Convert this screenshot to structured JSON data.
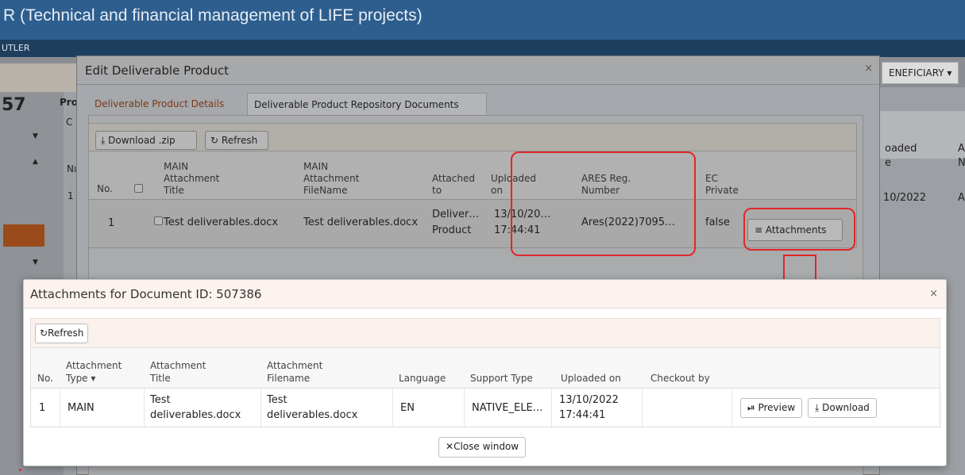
{
  "app": {
    "title": "R (Technical and financial management of LIFE projects)",
    "user": "UTLER",
    "beneficiary_label": "ENEFICIARY ▾",
    "left_number": "57",
    "proj_label": "Proj",
    "proj_c": "C",
    "bg_col_n": "Nı",
    "bg_row_one": "1",
    "right_uploaded": "oaded",
    "right_e": "e",
    "right_a": "A",
    "right_n": "N",
    "right_date": "10/2022",
    "right_a2": "A"
  },
  "edit_dialog": {
    "title": "Edit Deliverable Product",
    "close": "×",
    "tabs": [
      {
        "label": "Deliverable Product Details",
        "active": true
      },
      {
        "label": "Deliverable Product Repository Documents",
        "active": false
      }
    ],
    "toolbar": {
      "download_label": "⨯ Download .zip",
      "download_text": "Download .zip",
      "refresh_text": "Refresh"
    },
    "columns": {
      "no": "No.",
      "main_title_1": "MAIN",
      "main_title_2": "Attachment",
      "main_title_3": "Title",
      "main_file_1": "MAIN",
      "main_file_2": "Attachment",
      "main_file_3": "FileName",
      "attached_1": "Attached",
      "attached_2": "to",
      "uploaded_1": "Uploaded",
      "uploaded_2": "on",
      "ares_1": "ARES Reg.",
      "ares_2": "Number",
      "ec_1": "EC",
      "ec_2": "Private"
    },
    "rows": [
      {
        "no": "1",
        "title": "Test deliverables.docx",
        "filename": "Test deliverables.docx",
        "attached_1": "Deliver…",
        "attached_2": "Product",
        "uploaded_1": "13/10/20…",
        "uploaded_2": "17:44:41",
        "ares": "Ares(2022)7095…",
        "ec_private": "false",
        "attachments_label": "Attachments"
      }
    ]
  },
  "attachments_dialog": {
    "title": "Attachments for Document ID: 507386",
    "close": "×",
    "refresh_label": "Refresh",
    "columns": {
      "no": "No.",
      "type_1": "Attachment",
      "type_2": "Type ▾",
      "title_1": "Attachment",
      "title_2": "Title",
      "filename_1": "Attachment",
      "filename_2": "Filename",
      "language": "Language",
      "support_type": "Support Type",
      "uploaded_on": "Uploaded on",
      "checkout_by": "Checkout by"
    },
    "rows": [
      {
        "no": "1",
        "type": "MAIN",
        "title_1": "Test",
        "title_2": "deliverables.docx",
        "filename_1": "Test",
        "filename_2": "deliverables.docx",
        "language": "EN",
        "support_type": "NATIVE_ELE…",
        "uploaded_1": "13/10/2022",
        "uploaded_2": "17:44:41",
        "checkout_by": "",
        "preview_label": "Preview",
        "download_label": "Download"
      }
    ],
    "close_window_label": "Close window"
  },
  "colors": {
    "annotation_red": "#e0262a",
    "active_tab": "#7a3a17",
    "header_blue": "#2d5e8e"
  }
}
